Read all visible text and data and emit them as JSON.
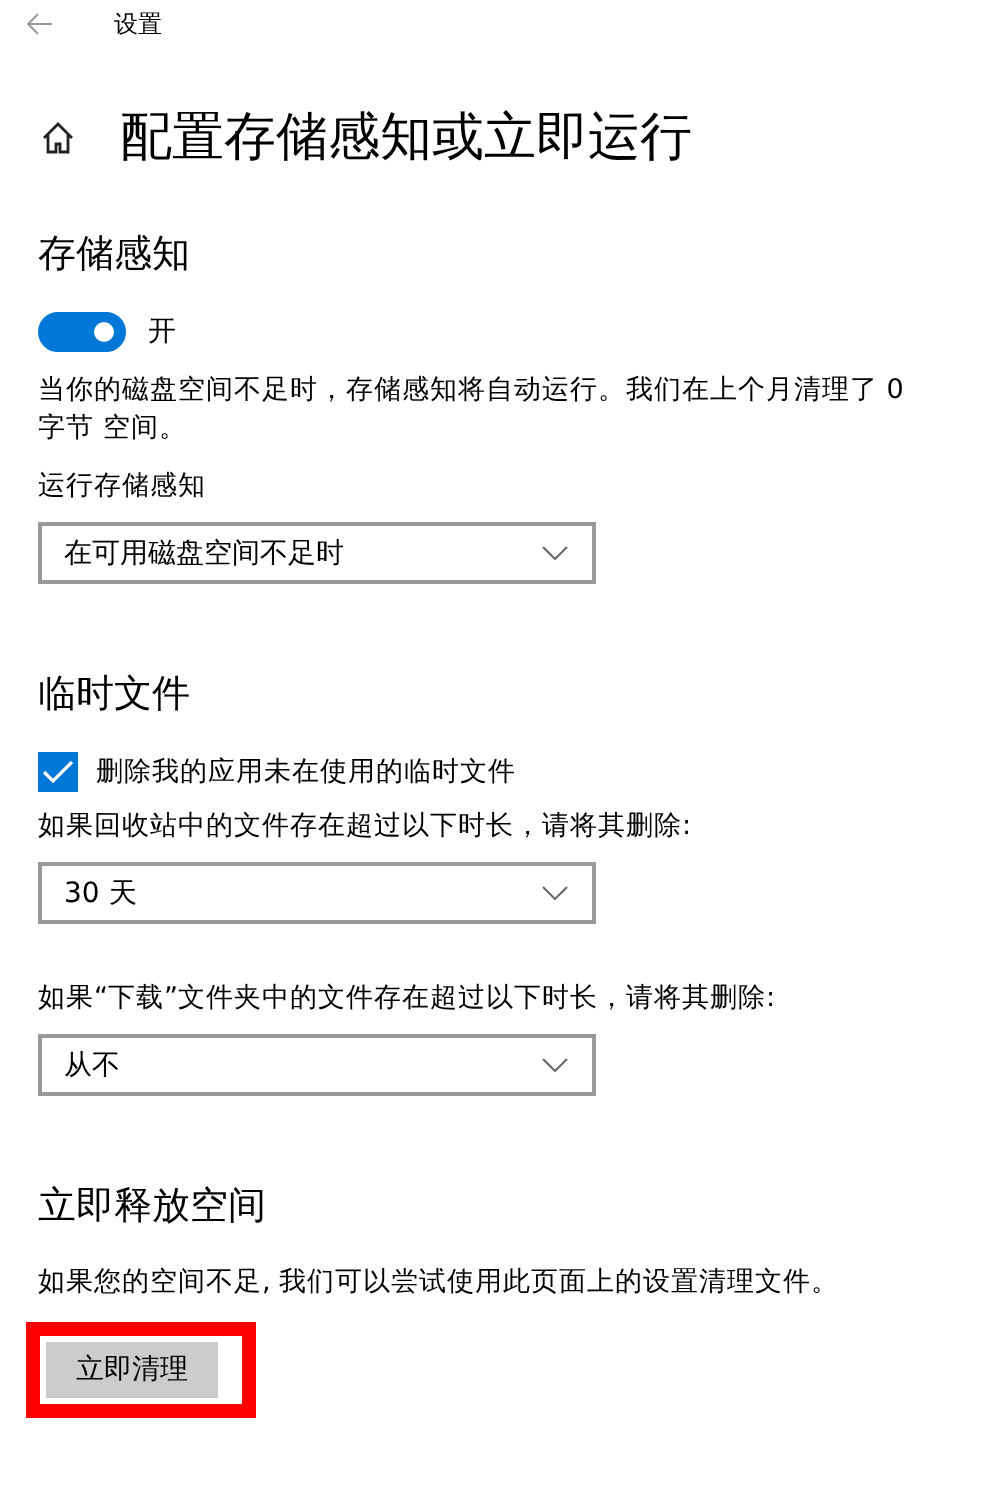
{
  "window": {
    "title": "设置"
  },
  "page": {
    "title": "配置存储感知或立即运行"
  },
  "sections": [
    {
      "title": "存储感知",
      "items": [
        {
          "kind": "toggle",
          "label": "开",
          "on": true
        },
        {
          "kind": "text",
          "text": "当你的磁盘空间不足时，存储感知将自动运行。我们在上个月清理了 0 字节 空间。"
        },
        {
          "kind": "dropdown",
          "label": "运行存储感知",
          "value": "在可用磁盘空间不足时"
        }
      ]
    },
    {
      "title": "临时文件",
      "items": [
        {
          "kind": "checkbox",
          "label": "删除我的应用未在使用的临时文件",
          "checked": true
        },
        {
          "kind": "dropdown",
          "label": "如果回收站中的文件存在超过以下时长，请将其删除:",
          "value": "30 天"
        },
        {
          "kind": "dropdown",
          "label": "如果“下载”文件夹中的文件存在超过以下时长，请将其删除:",
          "value": "从不"
        }
      ]
    },
    {
      "title": "立即释放空间",
      "items": [
        {
          "kind": "text",
          "text": "如果您的空间不足, 我们可以尝试使用此页面上的设置清理文件。"
        },
        {
          "kind": "button",
          "label": "立即清理",
          "highlighted": true
        }
      ]
    }
  ]
}
